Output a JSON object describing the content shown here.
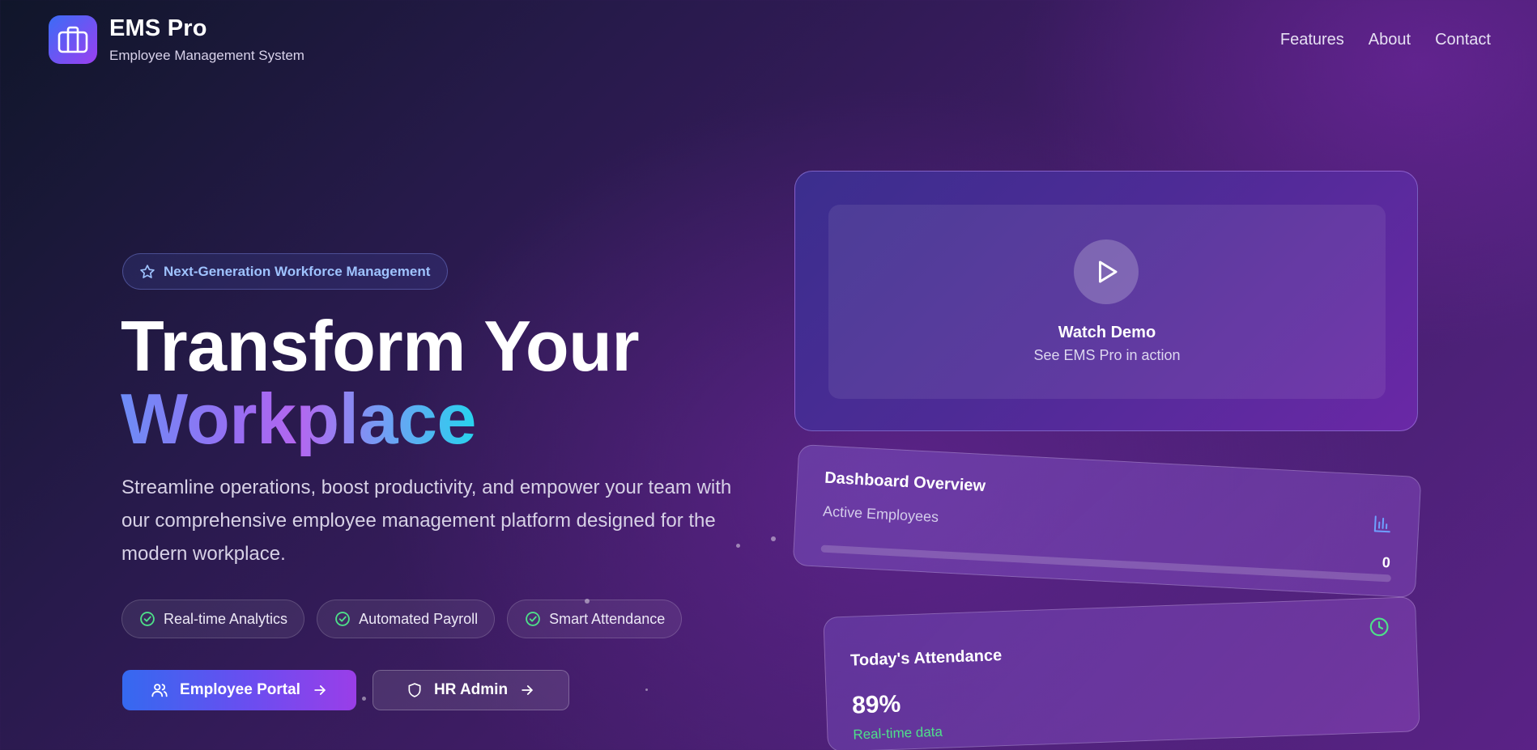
{
  "header": {
    "brand_title": "EMS Pro",
    "brand_subtitle": "Employee Management System",
    "logo_icon": "briefcase-icon",
    "nav": [
      {
        "label": "Features"
      },
      {
        "label": "About"
      },
      {
        "label": "Contact"
      }
    ]
  },
  "hero": {
    "badge": {
      "icon": "star-icon",
      "label": "Next-Generation Workforce Management"
    },
    "title_line1": "Transform Your",
    "title_line2": "Workplace",
    "description": "Streamline operations, boost productivity, and empower your team with our comprehensive employee management platform designed for the modern workplace.",
    "features": [
      {
        "icon": "check-circle-icon",
        "label": "Real-time Analytics"
      },
      {
        "icon": "check-circle-icon",
        "label": "Automated Payroll"
      },
      {
        "icon": "check-circle-icon",
        "label": "Smart Attendance"
      }
    ],
    "buttons": {
      "primary": {
        "icon": "users-icon",
        "label": "Employee Portal",
        "trail_icon": "arrow-right-icon"
      },
      "secondary": {
        "icon": "shield-icon",
        "label": "HR Admin",
        "trail_icon": "arrow-right-icon"
      }
    }
  },
  "video": {
    "icon": "play-icon",
    "title": "Watch Demo",
    "subtitle": "See EMS Pro in action"
  },
  "dashboard_card": {
    "title": "Dashboard Overview",
    "icon": "bar-chart-icon",
    "label": "Active Employees",
    "value": "0",
    "progress_fraction": 0
  },
  "attendance_card": {
    "title": "Today's Attendance",
    "icon": "clock-icon",
    "value": "89%",
    "subtitle": "Real-time data"
  },
  "colors": {
    "accent_blue": "#3569f0",
    "accent_purple": "#9a3ee8",
    "badge_text": "#9fc3ff",
    "success_green": "#4ee08a"
  }
}
